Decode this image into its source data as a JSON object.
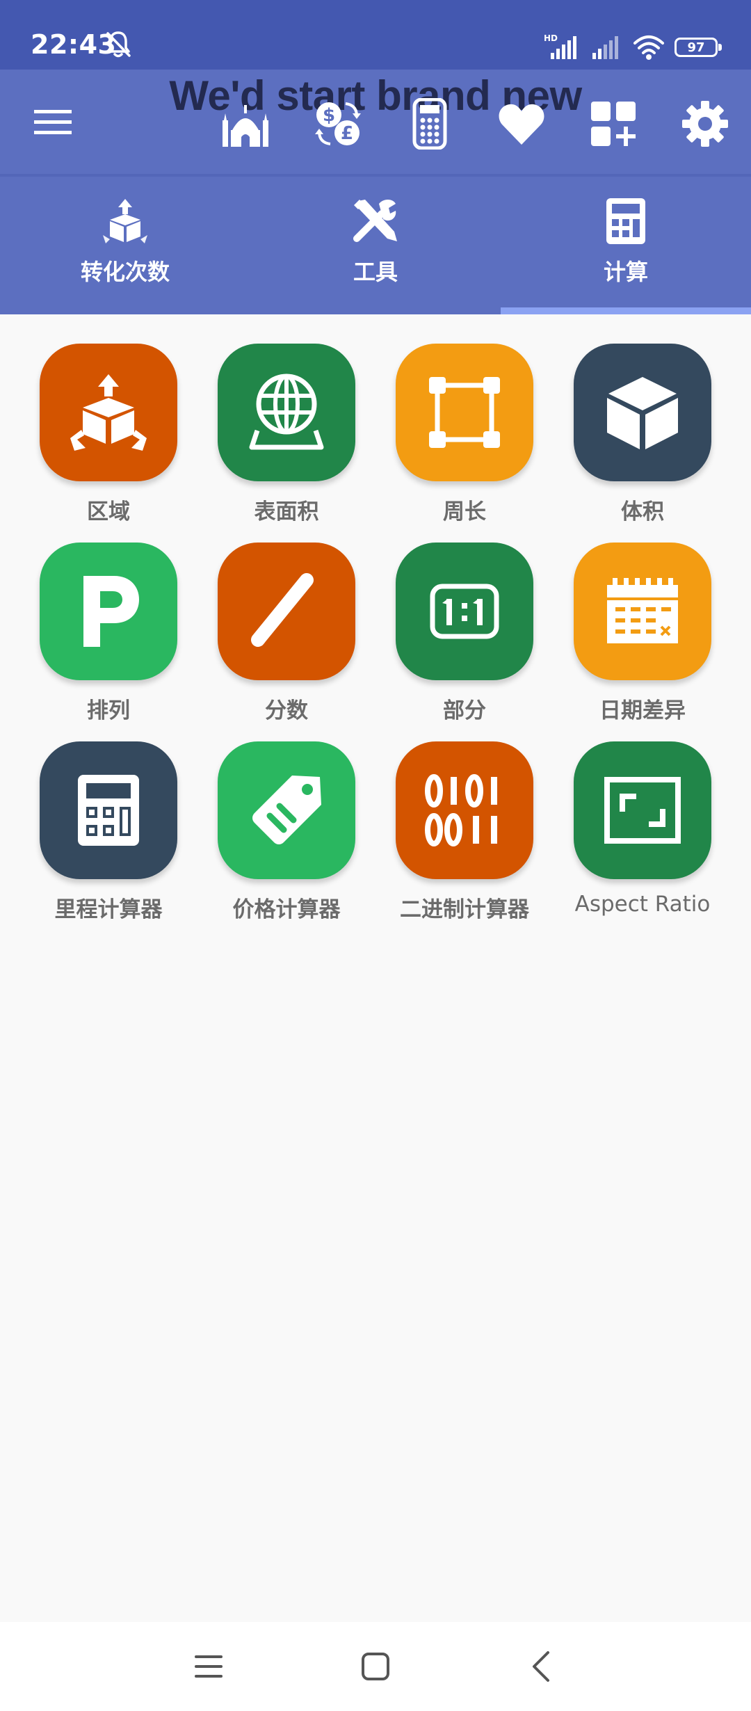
{
  "status_bar": {
    "time": "22:43",
    "battery": "97",
    "icons": [
      "mute-bell-icon",
      "hd-signal-icon",
      "signal-icon",
      "wifi-icon",
      "battery-icon"
    ]
  },
  "toolbar": {
    "title": "We'd start brand new",
    "icons": [
      "menu-icon",
      "mosque-icon",
      "currency-exchange-icon",
      "calculator-device-icon",
      "heart-icon",
      "add-widget-icon",
      "gear-icon"
    ]
  },
  "tabs": [
    {
      "label": "转化次数",
      "icon": "conversion-icon"
    },
    {
      "label": "工具",
      "icon": "tools-icon"
    },
    {
      "label": "计算",
      "icon": "calculator-icon",
      "selected": true
    }
  ],
  "tiles": [
    {
      "label": "区域",
      "icon": "area-icon",
      "color": "#d35400"
    },
    {
      "label": "表面积",
      "icon": "globe-icon",
      "color": "#218649"
    },
    {
      "label": "周长",
      "icon": "perimeter-icon",
      "color": "#f39c12"
    },
    {
      "label": "体积",
      "icon": "cube-icon",
      "color": "#34495e"
    },
    {
      "label": "排列",
      "icon": "permutation-p-icon",
      "color": "#2ab760"
    },
    {
      "label": "分数",
      "icon": "fraction-slash-icon",
      "color": "#d35400"
    },
    {
      "label": "部分",
      "icon": "ratio-icon",
      "color": "#218649"
    },
    {
      "label": "日期差异",
      "icon": "calendar-icon",
      "color": "#f39c12"
    },
    {
      "label": "里程计算器",
      "icon": "calculator-icon",
      "color": "#34495e"
    },
    {
      "label": "价格计算器",
      "icon": "price-tag-icon",
      "color": "#2ab760"
    },
    {
      "label": "二进制计算器",
      "icon": "binary-icon",
      "color": "#d35400"
    },
    {
      "label": "Aspect Ratio",
      "icon": "aspect-ratio-icon",
      "color": "#218649"
    }
  ],
  "nav_bar": {
    "icons": [
      "recents-icon",
      "home-icon",
      "back-icon"
    ]
  }
}
